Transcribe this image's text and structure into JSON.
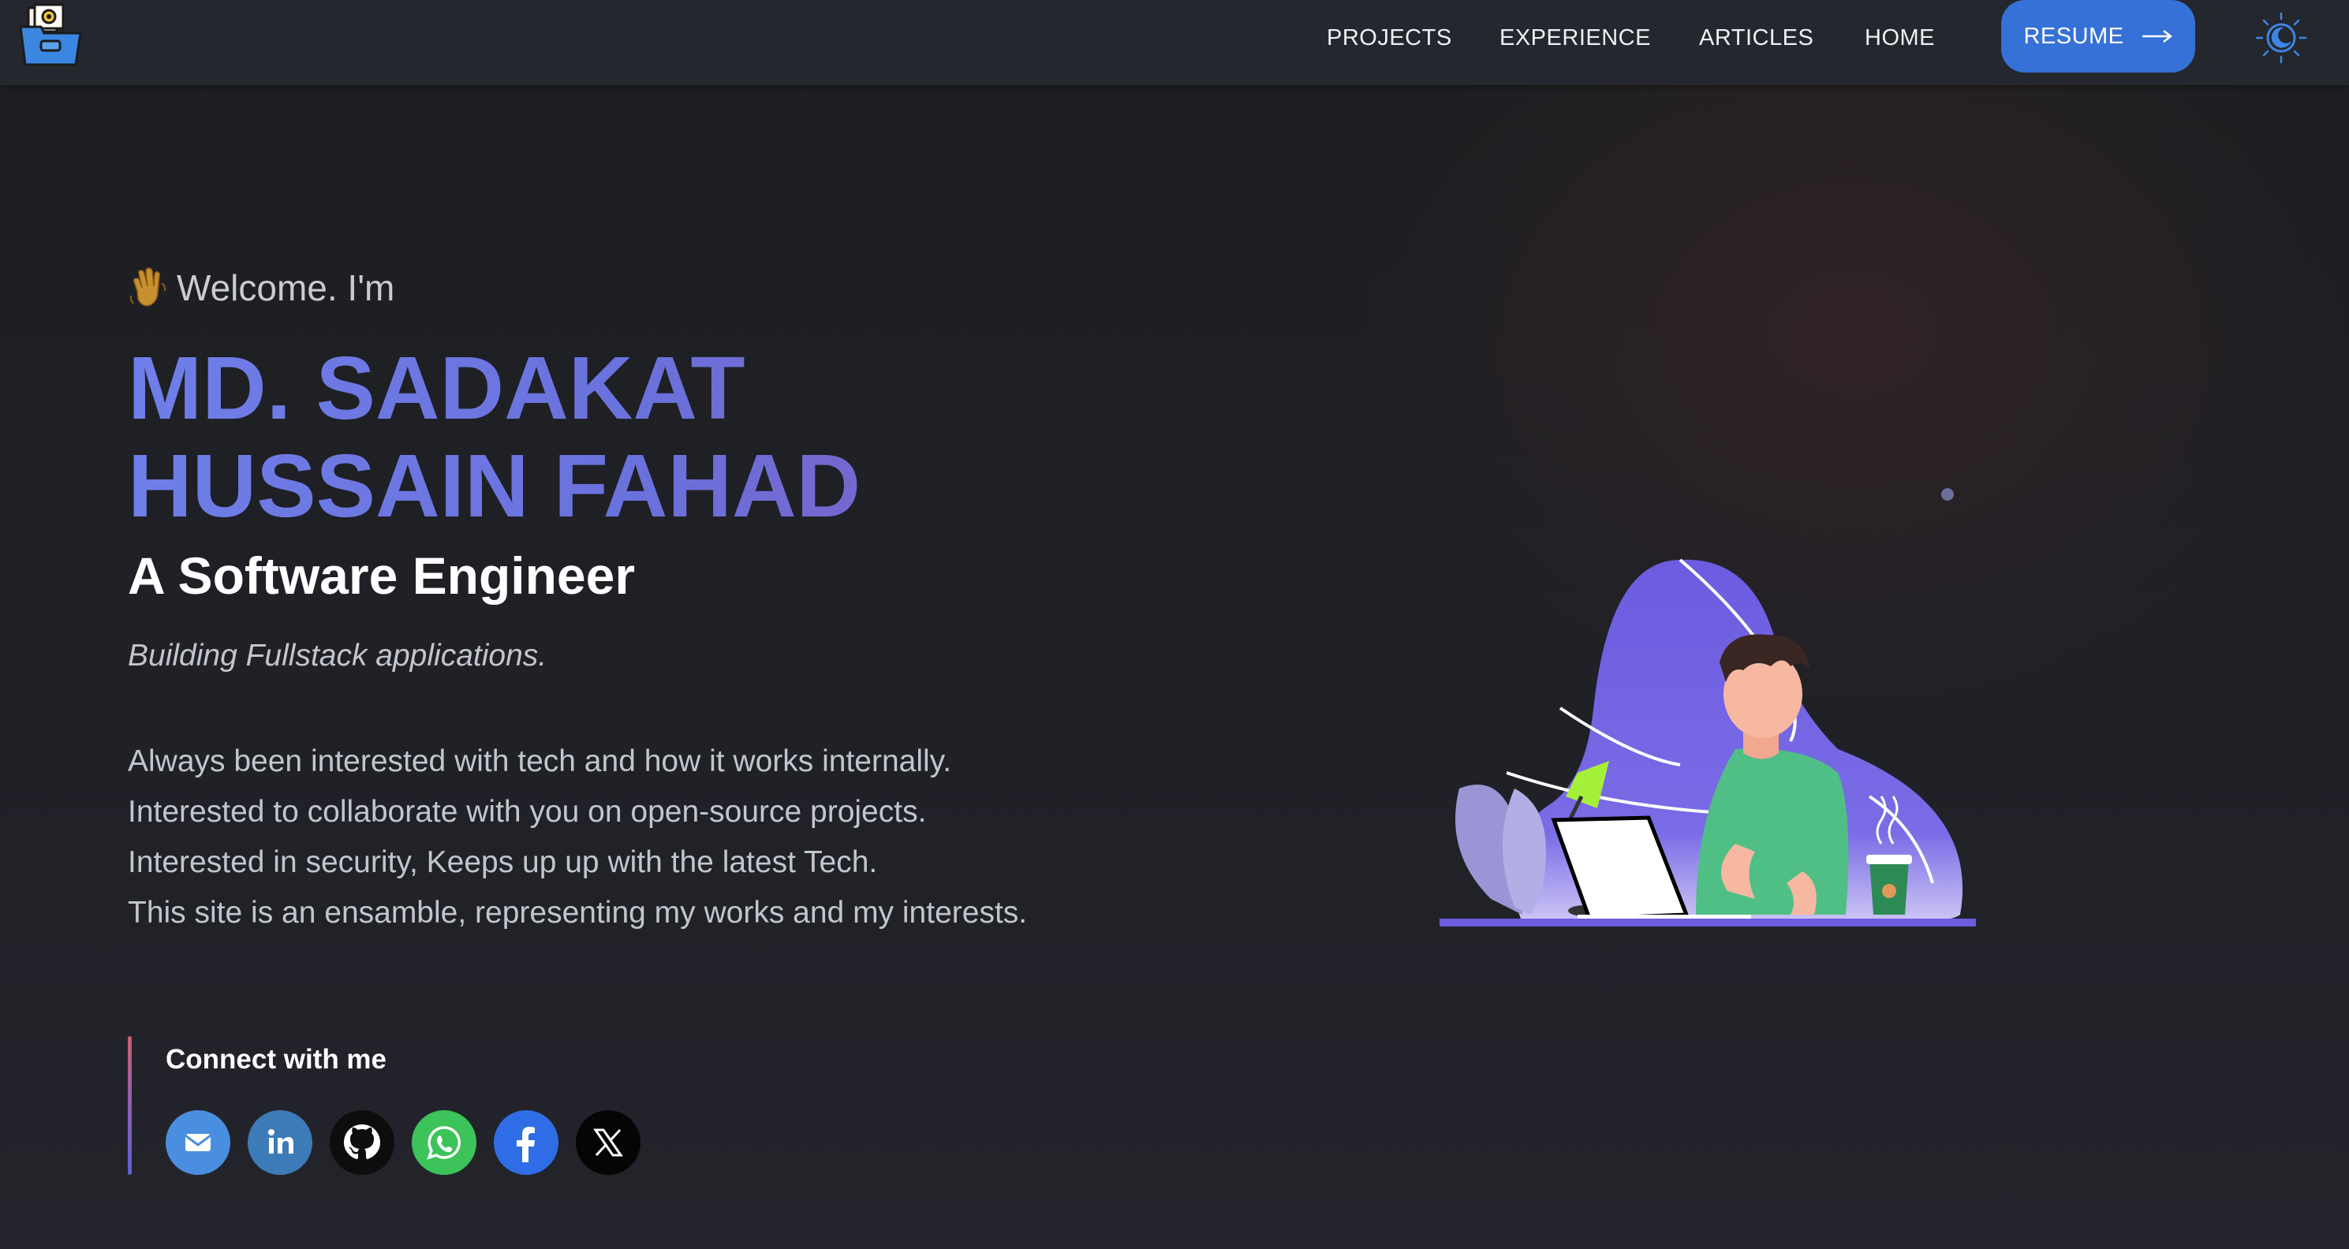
{
  "nav": {
    "links": [
      "PROJECTS",
      "EXPERIENCE",
      "ARTICLES",
      "HOME"
    ],
    "resume_label": "RESUME",
    "resume_icon": "arrow-right-icon",
    "theme_icon": "moon-sun-icon",
    "logo_icon": "folder-logo-icon"
  },
  "hero": {
    "welcome_emoji": "waving-hand-icon",
    "welcome_text": "Welcome. I'm",
    "name_line1": "MD. SADAKAT",
    "name_line2": "HUSSAIN FAHAD",
    "role": "A Software Engineer",
    "tagline": "Building Fullstack applications.",
    "bio": [
      "Always been interested with tech and how it works internally.",
      "Interested to collaborate with you on open-source projects.",
      "Interested in security, Keeps up up with the latest Tech.",
      "This site is an ensamble, representing my works and my interests."
    ]
  },
  "connect": {
    "title": "Connect with me",
    "socials": [
      "email-icon",
      "linkedin-icon",
      "github-icon",
      "whatsapp-icon",
      "facebook-icon",
      "x-icon"
    ]
  },
  "colors": {
    "accent": "#3571d6",
    "name_gradient_start": "#6f7ee8",
    "name_gradient_end": "#7c61c6",
    "navbar": "#24272d"
  }
}
